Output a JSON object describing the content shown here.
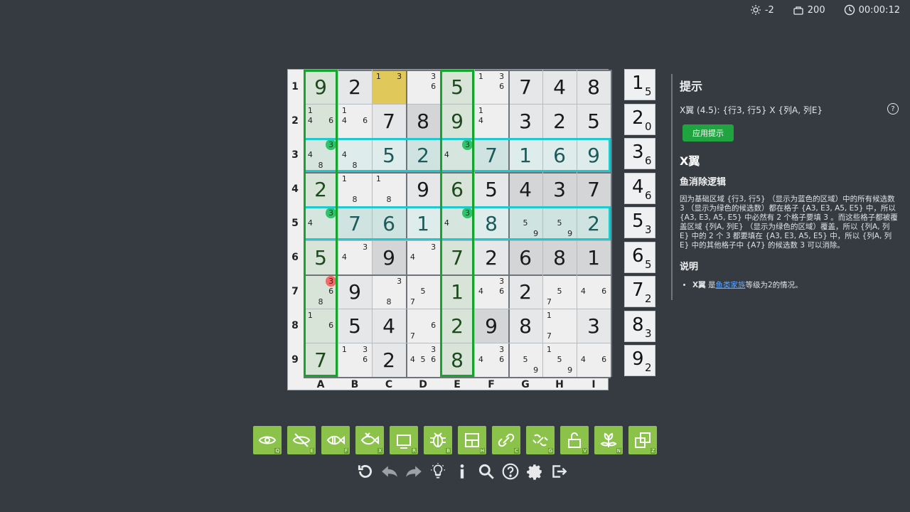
{
  "status": {
    "brightness": "-2",
    "score": "200",
    "timer": "00:00:12"
  },
  "rows": [
    "1",
    "2",
    "3",
    "4",
    "5",
    "6",
    "7",
    "8",
    "9"
  ],
  "cols": [
    "A",
    "B",
    "C",
    "D",
    "E",
    "F",
    "G",
    "H",
    "I"
  ],
  "grid": [
    [
      {
        "v": "9"
      },
      {
        "v": "2"
      },
      {
        "c": [
          "1",
          "",
          "3"
        ]
      },
      {
        "c": [
          "",
          "",
          "3",
          "",
          "",
          "6"
        ]
      },
      {
        "v": "5"
      },
      {
        "c": [
          "1",
          "",
          "3",
          "",
          "",
          "6"
        ]
      },
      {
        "v": "7"
      },
      {
        "v": "4"
      },
      {
        "v": "8"
      }
    ],
    [
      {
        "c": [
          "1",
          "",
          "",
          "4",
          "",
          "6"
        ]
      },
      {
        "c": [
          "1",
          "",
          "",
          "4",
          "",
          "6"
        ]
      },
      {
        "v": "7"
      },
      {
        "v": "8"
      },
      {
        "v": "9"
      },
      {
        "c": [
          "1",
          "",
          "",
          "4"
        ]
      },
      {
        "v": "3"
      },
      {
        "v": "2"
      },
      {
        "v": "5"
      }
    ],
    [
      {
        "c": [
          "",
          "",
          "3",
          "4",
          "",
          "",
          "",
          "8"
        ],
        "h": 2
      },
      {
        "c": [
          "",
          "",
          "",
          "4",
          "",
          "",
          "",
          "8"
        ]
      },
      {
        "v": "5"
      },
      {
        "v": "2"
      },
      {
        "c": [
          "",
          "",
          "3",
          "4"
        ],
        "h": 2
      },
      {
        "v": "7"
      },
      {
        "v": "1"
      },
      {
        "v": "6"
      },
      {
        "v": "9"
      }
    ],
    [
      {
        "v": "2"
      },
      {
        "c": [
          "1",
          "",
          "",
          "",
          "",
          "",
          "",
          "8"
        ]
      },
      {
        "c": [
          "1",
          "",
          "",
          "",
          "",
          "",
          "",
          "8"
        ]
      },
      {
        "v": "9"
      },
      {
        "v": "6"
      },
      {
        "v": "5"
      },
      {
        "v": "4"
      },
      {
        "v": "3"
      },
      {
        "v": "7"
      }
    ],
    [
      {
        "c": [
          "",
          "",
          "3",
          "4"
        ],
        "h": 2
      },
      {
        "v": "7"
      },
      {
        "v": "6"
      },
      {
        "v": "1"
      },
      {
        "c": [
          "",
          "",
          "3",
          "4"
        ],
        "h": 2
      },
      {
        "v": "8"
      },
      {
        "c": [
          "",
          "",
          "",
          "",
          "5",
          "",
          "",
          "",
          "9"
        ]
      },
      {
        "c": [
          "",
          "",
          "",
          "",
          "5",
          "",
          "",
          "",
          "9"
        ]
      },
      {
        "v": "2"
      }
    ],
    [
      {
        "v": "5"
      },
      {
        "c": [
          "",
          "",
          "3",
          "4"
        ]
      },
      {
        "v": "9"
      },
      {
        "c": [
          "",
          "",
          "3",
          "4"
        ]
      },
      {
        "v": "7"
      },
      {
        "v": "2"
      },
      {
        "v": "6"
      },
      {
        "v": "8"
      },
      {
        "v": "1"
      }
    ],
    [
      {
        "c": [
          "",
          "",
          "3",
          "",
          "",
          "6",
          "",
          "8"
        ],
        "r": 2
      },
      {
        "v": "9"
      },
      {
        "c": [
          "",
          "",
          "3",
          "",
          "",
          "",
          "",
          "8"
        ]
      },
      {
        "c": [
          "",
          "",
          "",
          "",
          "5",
          "",
          "7"
        ]
      },
      {
        "v": "1"
      },
      {
        "c": [
          "",
          "",
          "3",
          "4",
          "",
          "6"
        ]
      },
      {
        "v": "2"
      },
      {
        "c": [
          "",
          "",
          "",
          "",
          "5",
          "",
          "7"
        ]
      },
      {
        "c": [
          "",
          "",
          "",
          "4",
          "",
          "6"
        ]
      }
    ],
    [
      {
        "c": [
          "1",
          "",
          "",
          "",
          "",
          "6"
        ]
      },
      {
        "v": "5"
      },
      {
        "v": "4"
      },
      {
        "c": [
          "",
          "",
          "",
          "",
          "",
          "6",
          "7"
        ]
      },
      {
        "v": "2"
      },
      {
        "v": "9"
      },
      {
        "v": "8"
      },
      {
        "c": [
          "1",
          "",
          "",
          "",
          "",
          "",
          "7"
        ]
      },
      {
        "v": "3"
      }
    ],
    [
      {
        "v": "7"
      },
      {
        "c": [
          "1",
          "",
          "3",
          "",
          "",
          "6"
        ]
      },
      {
        "v": "2"
      },
      {
        "c": [
          "",
          "",
          "3",
          "4",
          "5",
          "6"
        ]
      },
      {
        "v": "8"
      },
      {
        "c": [
          "",
          "",
          "3",
          "4",
          "",
          "6"
        ]
      },
      {
        "c": [
          "",
          "",
          "",
          "",
          "5",
          "",
          "",
          "",
          "9"
        ]
      },
      {
        "c": [
          "1",
          "",
          "",
          "",
          "5",
          "",
          "",
          "",
          "9"
        ]
      },
      {
        "c": [
          "",
          "",
          "",
          "4",
          "",
          "6"
        ]
      }
    ]
  ],
  "numpad": [
    {
      "n": "1",
      "c": "5"
    },
    {
      "n": "2",
      "c": "0"
    },
    {
      "n": "3",
      "c": "6"
    },
    {
      "n": "4",
      "c": "6"
    },
    {
      "n": "5",
      "c": "3"
    },
    {
      "n": "6",
      "c": "5"
    },
    {
      "n": "7",
      "c": "2"
    },
    {
      "n": "8",
      "c": "3"
    },
    {
      "n": "9",
      "c": "2"
    }
  ],
  "hint": {
    "title": "提示",
    "summary": "X翼 (4.5): {行3, 行5} X {列A, 列E}",
    "apply": "应用提示",
    "name": "X翼",
    "logic_title": "鱼消除逻辑",
    "logic": "因为基础区域 {行3, 行5} （显示为蓝色的区域）中的所有候选数 3 （显示为绿色的候选数）都在格子 {A3, E3, A5, E5} 中，所以 {A3, E3, A5, E5} 中必然有 2 个格子要填 3 。而这些格子都被覆盖区域 {列A, 列E} （显示为绿色的区域）覆盖，所以 {列A, 列E} 中的 2 个 3 都要填在 {A3, E3, A5, E5} 中，所以 {列A, 列E} 中的其他格子中 {A7} 的候选数 3 可以消除。",
    "note_title": "说明",
    "note_pre": "X翼",
    "note_mid": " 是",
    "note_link": "鱼类家族",
    "note_post": "等级为2的情况。"
  },
  "toolbar": [
    {
      "name": "eye",
      "k": "Q"
    },
    {
      "name": "eye-off",
      "k": "E"
    },
    {
      "name": "fish",
      "k": "F"
    },
    {
      "name": "fish-x",
      "k": "X"
    },
    {
      "name": "rect",
      "k": "R"
    },
    {
      "name": "bug",
      "k": "B"
    },
    {
      "name": "split",
      "k": "H"
    },
    {
      "name": "chain",
      "k": "C"
    },
    {
      "name": "chain2",
      "k": "G"
    },
    {
      "name": "lock",
      "k": "V"
    },
    {
      "name": "flower",
      "k": "N"
    },
    {
      "name": "squares",
      "k": "Z"
    }
  ],
  "colors": {
    "accent": "#8bc34a",
    "cyan": "#21c9cf",
    "green": "#16a52c",
    "selected": "#e0c95a"
  }
}
